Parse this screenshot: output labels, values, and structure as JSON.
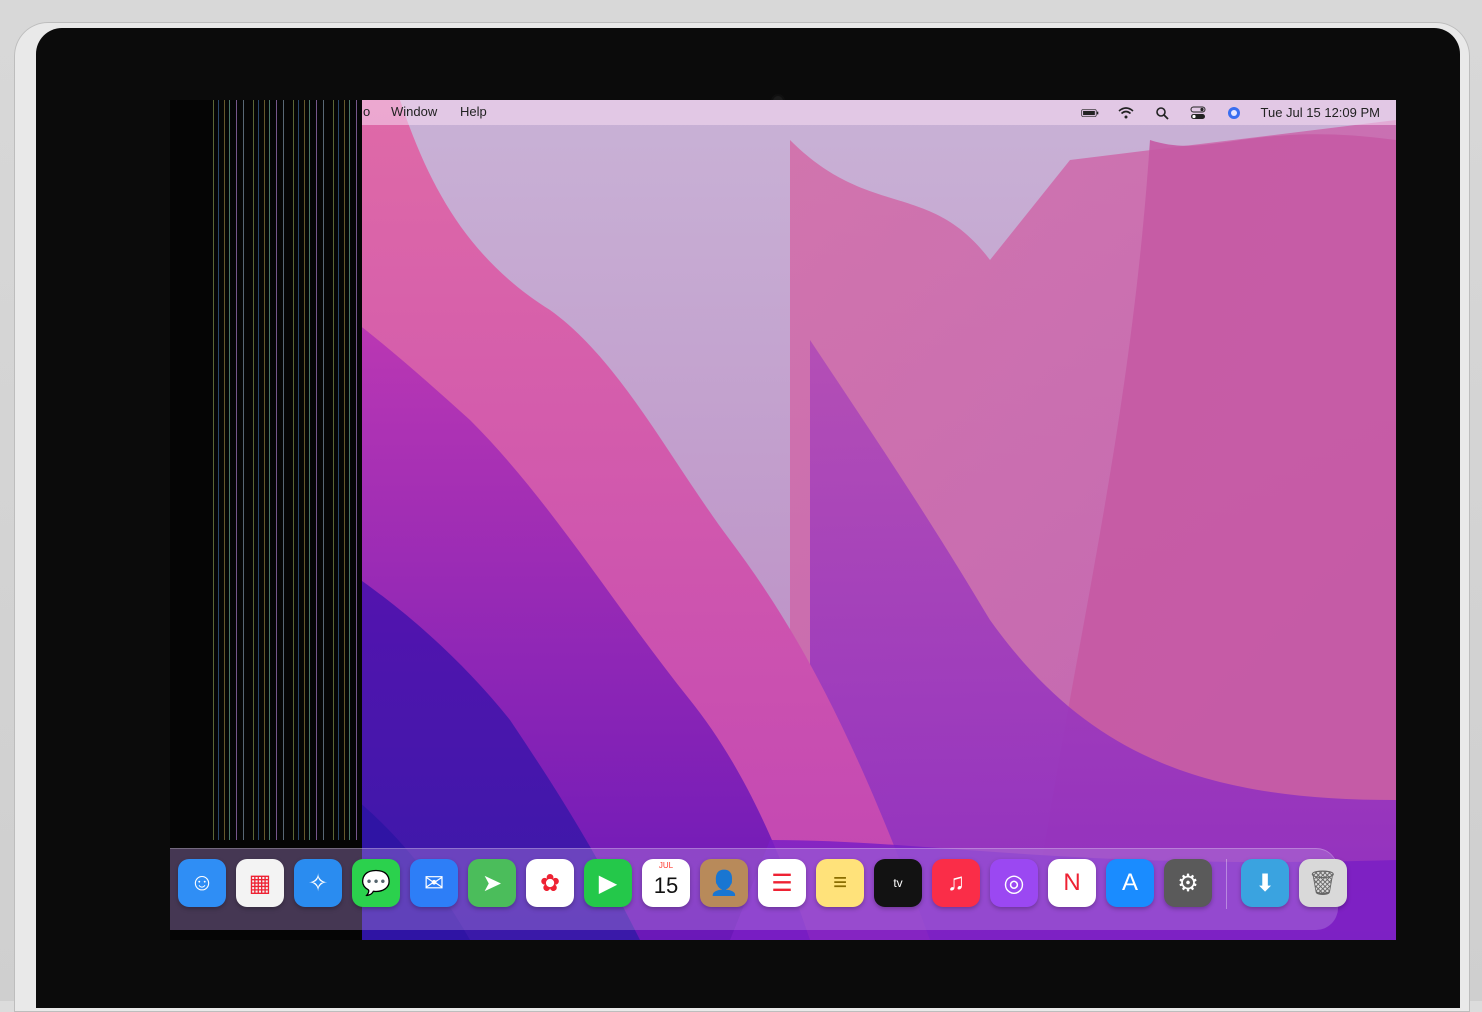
{
  "menubar": {
    "items": [
      "o",
      "Window",
      "Help"
    ],
    "clock": "Tue Jul 15  12:09 PM",
    "icons": [
      "battery-icon",
      "wifi-icon",
      "search-icon",
      "control-center-icon",
      "siri-icon"
    ]
  },
  "dock": {
    "apps": [
      {
        "name": "Finder",
        "icon": "finder-icon",
        "bg": "#2f8ef5"
      },
      {
        "name": "Launchpad",
        "icon": "launchpad-icon",
        "bg": "#f3f3f3"
      },
      {
        "name": "Safari",
        "icon": "safari-icon",
        "bg": "#2a8cf0"
      },
      {
        "name": "Messages",
        "icon": "messages-icon",
        "bg": "#2bd14d"
      },
      {
        "name": "Mail",
        "icon": "mail-icon",
        "bg": "#2d7ef7"
      },
      {
        "name": "Maps",
        "icon": "maps-icon",
        "bg": "#4bbd5b"
      },
      {
        "name": "Photos",
        "icon": "photos-icon",
        "bg": "#ffffff"
      },
      {
        "name": "FaceTime",
        "icon": "facetime-icon",
        "bg": "#24c84a"
      },
      {
        "name": "Calendar",
        "icon": "calendar-icon",
        "bg": "#ffffff",
        "month": "JUL",
        "day": "15"
      },
      {
        "name": "Contacts",
        "icon": "contacts-icon",
        "bg": "#b88a5a"
      },
      {
        "name": "Reminders",
        "icon": "reminders-icon",
        "bg": "#ffffff"
      },
      {
        "name": "Notes",
        "icon": "notes-icon",
        "bg": "#ffe27a"
      },
      {
        "name": "TV",
        "icon": "apple-tv-icon",
        "bg": "#121212",
        "label": "tv"
      },
      {
        "name": "Music",
        "icon": "music-icon",
        "bg": "#fa2d48"
      },
      {
        "name": "Podcasts",
        "icon": "podcasts-icon",
        "bg": "#9b48f2"
      },
      {
        "name": "News",
        "icon": "news-icon",
        "bg": "#ffffff"
      },
      {
        "name": "App Store",
        "icon": "app-store-icon",
        "bg": "#1a8cff"
      },
      {
        "name": "System Preferences",
        "icon": "system-preferences-icon",
        "bg": "#5a5a5a"
      }
    ],
    "right": [
      {
        "name": "Downloads",
        "icon": "downloads-folder-icon",
        "bg": "#3aa3e0"
      },
      {
        "name": "Trash",
        "icon": "trash-icon",
        "bg": "#d9d9d9"
      }
    ]
  }
}
